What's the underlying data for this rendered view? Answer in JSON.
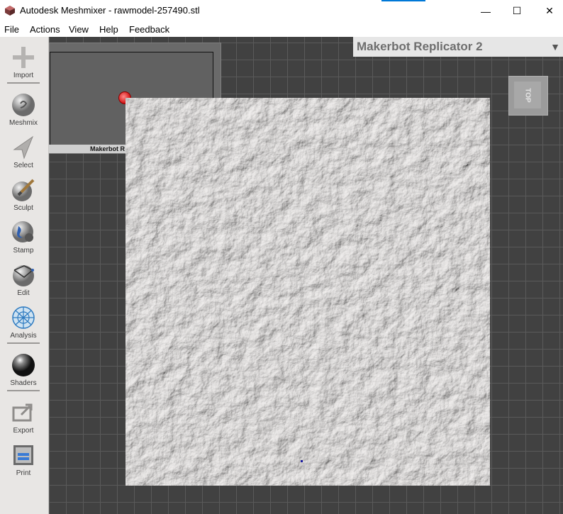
{
  "window": {
    "title": "Autodesk Meshmixer - rawmodel-257490.stl",
    "controls": {
      "minimize": "—",
      "maximize": "☐",
      "close": "✕"
    }
  },
  "menu": {
    "items": [
      "File",
      "Actions",
      "View",
      "Help",
      "Feedback"
    ]
  },
  "toolbar": {
    "tools": [
      {
        "label": "Import",
        "icon": "plus-icon"
      },
      {
        "label": "Meshmix",
        "icon": "meshmix-sphere-icon"
      },
      {
        "label": "Select",
        "icon": "select-arrow-icon"
      },
      {
        "label": "Sculpt",
        "icon": "brush-sphere-icon"
      },
      {
        "label": "Stamp",
        "icon": "stamp-icon"
      },
      {
        "label": "Edit",
        "icon": "edit-sphere-icon"
      },
      {
        "label": "Analysis",
        "icon": "analysis-sphere-icon"
      },
      {
        "label": "Shaders",
        "icon": "shader-sphere-icon"
      },
      {
        "label": "Export",
        "icon": "export-icon"
      },
      {
        "label": "Print",
        "icon": "printer-icon"
      }
    ]
  },
  "viewport": {
    "printer_selected": "Makerbot Replicator 2",
    "build_plate_label": "Makerbot R",
    "viewcube_face": "TOP"
  },
  "colors": {
    "viewport_bg": "#414141",
    "grid_line": "#5a5a5a",
    "model_surface": "#e8e5e4",
    "origin_marker": "#d01010"
  }
}
